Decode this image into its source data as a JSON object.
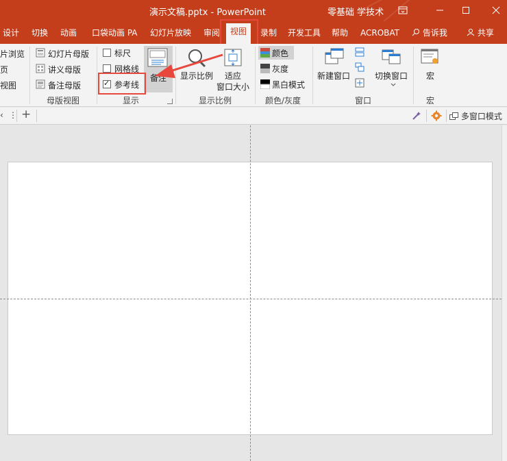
{
  "window": {
    "title": "演示文稿.pptx  -  PowerPoint",
    "account": "零基础 学技术",
    "controls": {
      "ribbon_display": "ribbon-display-icon",
      "minimize": "minimize-icon",
      "maximize": "maximize-icon",
      "close": "close-icon"
    }
  },
  "tabs": [
    {
      "label": "设计"
    },
    {
      "label": "切换"
    },
    {
      "label": "动画"
    },
    {
      "label": "口袋动画 PA"
    },
    {
      "label": "幻灯片放映"
    },
    {
      "label": "审阅"
    },
    {
      "label": "视图",
      "active": true
    },
    {
      "label": "录制"
    },
    {
      "label": "开发工具"
    },
    {
      "label": "帮助"
    },
    {
      "label": "ACROBAT"
    },
    {
      "label": "告诉我"
    },
    {
      "label": "共享"
    }
  ],
  "ribbon": {
    "presentation_views": {
      "slide_sorter": "片浏览",
      "reading": "页",
      "normal": "视图"
    },
    "master_views": {
      "slide_master": "幻灯片母版",
      "handout_master": "讲义母版",
      "notes_master": "备注母版",
      "group_label": "母版视图"
    },
    "show": {
      "ruler": {
        "label": "标尺",
        "checked": false
      },
      "gridlines": {
        "label": "网格线",
        "checked": false
      },
      "guides": {
        "label": "参考线",
        "checked": true
      },
      "notes": "备注",
      "group_label": "显示"
    },
    "zoom": {
      "zoom": "显示比例",
      "fit_line1": "适应",
      "fit_line2": "窗口大小",
      "group_label": "显示比例"
    },
    "color": {
      "color": "颜色",
      "grayscale": "灰度",
      "bw": "黑白模式",
      "group_label": "颜色/灰度"
    },
    "window": {
      "new_window": "新建窗口",
      "switch_window": "切换窗口",
      "group_label": "窗口"
    },
    "macros": {
      "macros": "宏",
      "group_label": "宏"
    }
  },
  "strip": {
    "multi_window_mode": "多窗口模式"
  },
  "colors": {
    "accent": "#c43e1c",
    "highlight_box": "#e8473c"
  }
}
